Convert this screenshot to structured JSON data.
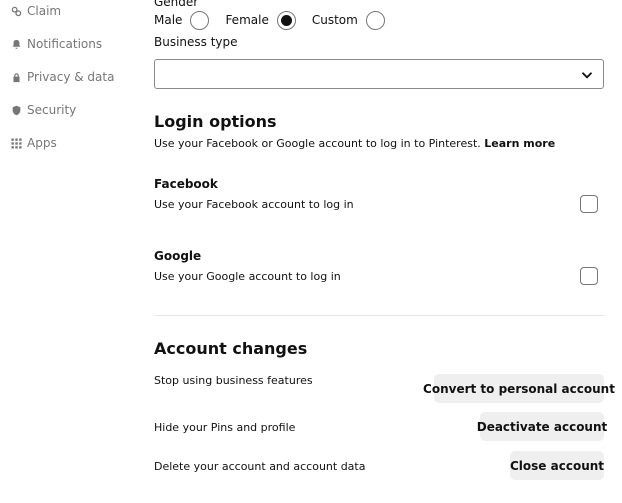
{
  "sidebar": {
    "items": [
      {
        "label": "Claim",
        "icon": "claim-icon"
      },
      {
        "label": "Notifications",
        "icon": "bell-icon"
      },
      {
        "label": "Privacy & data",
        "icon": "lock-icon"
      },
      {
        "label": "Security",
        "icon": "shield-icon"
      },
      {
        "label": "Apps",
        "icon": "grid-icon"
      }
    ]
  },
  "profile": {
    "gender_label": "Gender",
    "gender_options": [
      {
        "label": "Male",
        "selected": false
      },
      {
        "label": "Female",
        "selected": true
      },
      {
        "label": "Custom",
        "selected": false
      }
    ],
    "business_type_label": "Business type",
    "business_type_value": ""
  },
  "login_options": {
    "title": "Login options",
    "description": "Use your Facebook or Google account to log in to Pinterest.",
    "learn_more": "Learn more",
    "facebook": {
      "title": "Facebook",
      "description": "Use your Facebook account to log in",
      "checked": false
    },
    "google": {
      "title": "Google",
      "description": "Use your Google account to log in",
      "checked": false
    }
  },
  "account_changes": {
    "title": "Account changes",
    "rows": [
      {
        "text": "Stop using business features",
        "button": "Convert to personal account"
      },
      {
        "text": "Hide your Pins and profile",
        "button": "Deactivate account"
      },
      {
        "text": "Delete your account and account data",
        "button": "Close account"
      }
    ]
  }
}
